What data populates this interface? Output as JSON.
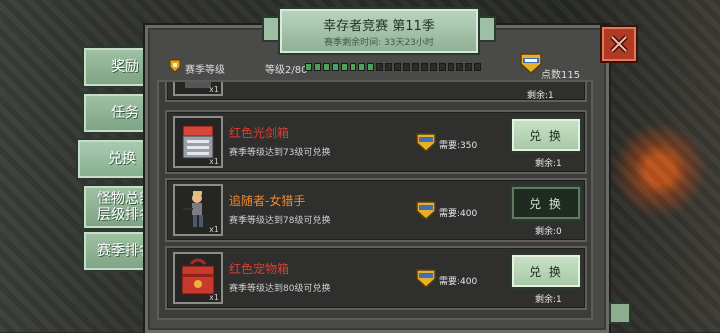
{
  "title": "幸存者竞赛 第11季",
  "subtitle": "赛季剩余时间: 33天23小时",
  "tabs": [
    "奖励",
    "任务",
    "兑换",
    "怪物总部\n层级排名",
    "赛季排名"
  ],
  "header": {
    "season_level_label": "赛季等级",
    "level_text": "等级2/80",
    "level_progress": 0.4,
    "points_text": "点数115"
  },
  "items": [
    {
      "qty": "x1",
      "remain": "剩余:1"
    },
    {
      "name": "红色光剑箱",
      "desc": "赛季等级达到73级可兑换",
      "cost": "需要:350",
      "button": "兑 换",
      "remain": "剩余:1",
      "qty": "x1"
    },
    {
      "name": "追随者-女猎手",
      "desc": "赛季等级达到78级可兑换",
      "cost": "需要:400",
      "button": "兑 换",
      "remain": "剩余:0",
      "qty": "x1"
    },
    {
      "name": "红色宠物箱",
      "desc": "赛季等级达到80级可兑换",
      "cost": "需要:400",
      "button": "兑 换",
      "remain": "剩余:1",
      "qty": "x1"
    }
  ]
}
